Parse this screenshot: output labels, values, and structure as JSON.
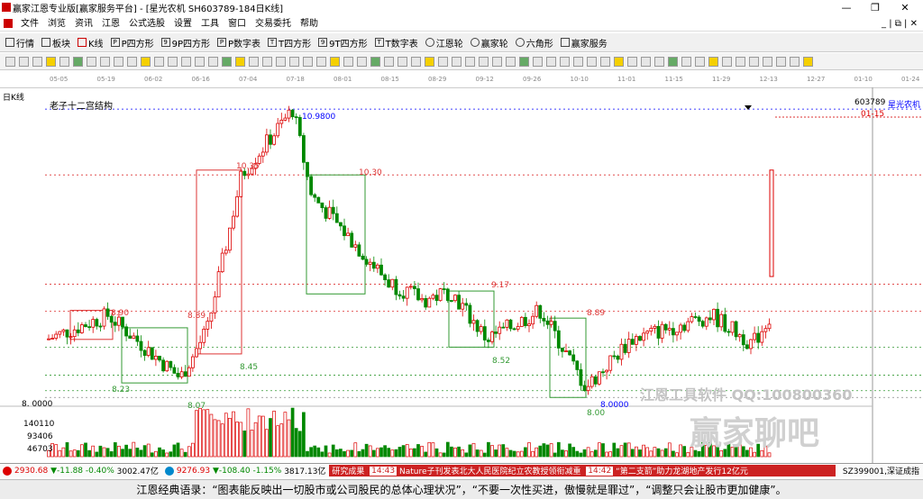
{
  "window": {
    "title": "赢家江恩专业版[赢家服务平台] - [星光农机  SH603789-184日K线]"
  },
  "menu": [
    "文件",
    "浏览",
    "资讯",
    "江恩",
    "公式选股",
    "设置",
    "工具",
    "窗口",
    "交易委托",
    "帮助"
  ],
  "nav": [
    "行情",
    "板块",
    "K线",
    "P四方形",
    "9P四方形",
    "P数字表",
    "T四方形",
    "9T四方形",
    "T数字表",
    "江恩轮",
    "赢家轮",
    "六角形",
    "赢家服务"
  ],
  "chart": {
    "period_label": "日K线",
    "structure_label": "老子十二宫结构",
    "code": "603789",
    "name": "星光农机",
    "date_marker": "01-15",
    "dates": [
      "05-05",
      "05-19",
      "06-02",
      "06-16",
      "07-04",
      "07-18",
      "08-01",
      "08-15",
      "08-29",
      "09-12",
      "09-26",
      "10-10",
      "11-01",
      "11-15",
      "11-29",
      "12-13",
      "12-27",
      "01-10",
      "01-24"
    ],
    "price_labels": [
      "10.9800",
      "10.35",
      "10.30",
      "9.17",
      "8.90",
      "8.89",
      "8.89",
      "8.45",
      "8.52",
      "8.23",
      "8.07",
      "8.00",
      "8.0000",
      "8. 0000"
    ],
    "volume_ticks": [
      "140110",
      "93406",
      "46703"
    ],
    "watermark": "江恩工具软件 QQ:100800360",
    "watermark2": "赢家聊吧"
  },
  "status": {
    "sh": {
      "val": "2930.68",
      "chg": "▼-11.88",
      "pct": "-0.40%",
      "amt": "3002.47亿"
    },
    "sz": {
      "val": "9276.93",
      "chg": "▼-108.40",
      "pct": "-1.15%",
      "amt": "3817.13亿"
    },
    "news": [
      {
        "time": "",
        "text": "研究成果"
      },
      {
        "time": "14:43",
        "text": "Nature子刊发表北大人民医院纪立农教授领衔减重"
      },
      {
        "time": "14:42",
        "text": "“第二支箭”助力龙湖地产发行12亿元"
      }
    ],
    "code": "SZ399001,深证成指"
  },
  "quote": "江恩经典语录：“图表能反映出一切股市或公司股民的总体心理状况”，“不要一次性买进，傲慢就是罪过”，“调整只会让股市更加健康”。"
}
